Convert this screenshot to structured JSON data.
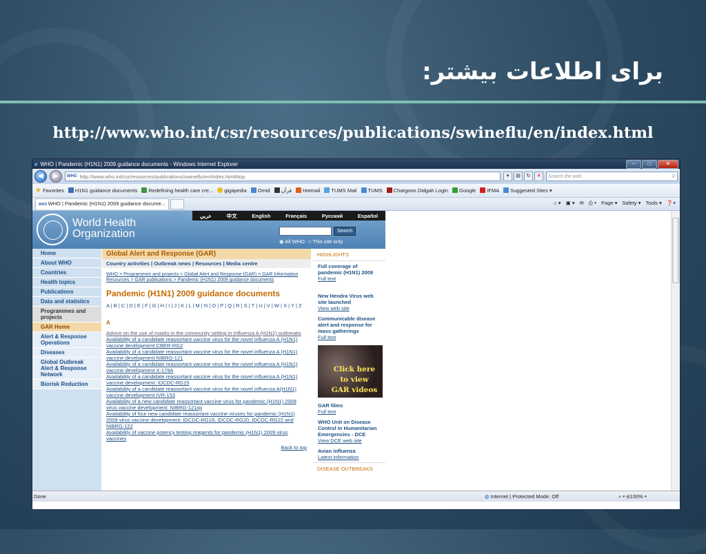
{
  "slide": {
    "title": "برای اطلاعات بیشتر:",
    "url": "http://www.who.int/csr/resources/publications/swineflu/en/index.html"
  },
  "browser": {
    "window_title": "WHO | Pandemic (H1N1) 2009 guidance documents - Windows Internet Explorer",
    "address": "http://www.who.int/csr/resources/publications/swineflu/en/index.html#top",
    "search_placeholder": "Search the web",
    "favorites_label": "Favorites",
    "favorites": [
      "H1N1 guidance documents",
      "Redefining health care cre...",
      "gigapedia",
      "Omid",
      "قرآن",
      "Hotmail",
      "TUMS Mail",
      "TUMS",
      "Chargoon Didgah Login",
      "Google",
      "IFMA",
      "Suggested Sites ▾"
    ],
    "tab_title": "WHO | Pandemic (H1N1) 2009 guidance docume...",
    "commands": [
      "Page ▾",
      "Safety ▾",
      "Tools ▾"
    ],
    "status_left": "Done",
    "status_zone": "Internet | Protected Mode: Off",
    "zoom": "100%"
  },
  "who": {
    "org_name_1": "World Health",
    "org_name_2": "Organization",
    "languages": [
      "عربي",
      "中文",
      "English",
      "Français",
      "Русский",
      "Español"
    ],
    "search_button": "Search",
    "radio_all": "All WHO",
    "radio_site": "This site only",
    "nav": [
      "Home",
      "About WHO",
      "Countries",
      "Health topics",
      "Publications",
      "Data and statistics",
      "Programmes and projects",
      "GAR Home",
      "Alert & Response Operations",
      "Diseases",
      "Global Outbreak Alert & Response Network",
      "Biorisk Reduction"
    ],
    "section_title": "Global Alert and Response (GAR)",
    "section_links": "Country activities | Outbreak news | Resources | Media centre",
    "breadcrumb": "WHO > Programmes and projects > Global Alert and Response (GAR) > GAR Information Resources > GAR publications > Pandemic (H1N1) 2009 guidance documents",
    "page_title": "Pandemic (H1N1) 2009 guidance documents",
    "alphabet": "A | B | C | D | E | F | G | H | I | J | K | L | M | N | O | P | Q | R | S | T | U | V | W | X | Y | Z",
    "section_letter": "A",
    "documents": [
      "Advice on the use of masks in the community setting in Influenza A (H1N1) outbreaks",
      "Availability of a candidate reassortant vaccine virus for the novel influenza A (H1N1) vaccine development CBER-RG2",
      "Availability of a candidate reassortant vaccine virus for the novel influenza A (H1N1) vaccine development NIBRG-121",
      "Availability of a candidate reassortant vaccine virus for the novel influenza A (H1N1) vaccine development X-179A",
      "Availability of a candidate reassortant vaccine virus for the novel influenza A (H1N1) vaccine development: IDCDC-RG15",
      "Availability of a candidate reassortant vaccine virus for the novel influenza A(H1N1) vaccine development IVR-153",
      "Availability of a new candidate reassortant vaccine virus for pandemic (H1N1) 2009 virus vaccine development: NIBRG-121xp",
      "Availability of four new candidate reassortant vaccine viruses for pandemic (H1N1) 2009 virus vaccine development: IDCDC-RG18, IDCDC-RG20, IDCDC-RG22 and NIBRG-122",
      "Availability of vaccine potency testing reagents for pandemic (H1N1) 2009 virus vaccines"
    ],
    "back_to_top": "Back to top",
    "highlights_title": "HIGHLIGHTS",
    "highlights": [
      {
        "title": "Full coverage of pandemic (H1N1) 2009",
        "link": "Full text"
      },
      {
        "title": "New Hendra Virus web site launched",
        "link": "View web site"
      },
      {
        "title": "Communicable disease alert and response for mass gatherings",
        "link": "Full text"
      }
    ],
    "video_text": "Click here to view GAR videos",
    "highlights2": [
      {
        "title": "GAR films",
        "link": "Full text"
      },
      {
        "title": "WHO Unit on Disease Control in Humanitarian Emergencies - DCE",
        "link": "View DCE web site"
      },
      {
        "title": "Avian influenza",
        "link": "Latest information"
      }
    ],
    "disease_outbreaks": "DISEASE OUTBREAKS"
  }
}
